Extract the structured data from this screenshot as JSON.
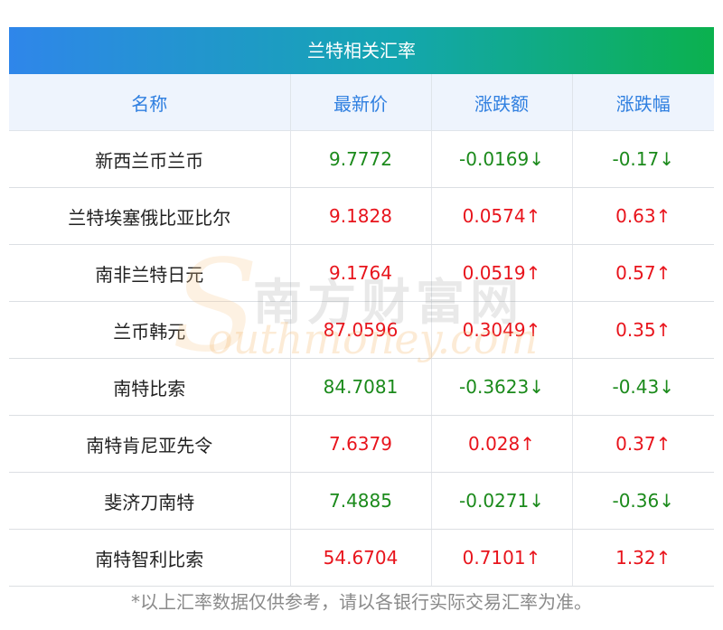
{
  "title": "兰特相关汇率",
  "headers": [
    "名称",
    "最新价",
    "涨跌额",
    "涨跌幅"
  ],
  "rows": [
    {
      "name": "新西兰币兰币",
      "price": "9.7772",
      "change": "-0.0169↓",
      "pct": "-0.17↓",
      "dir": "down"
    },
    {
      "name": "兰特埃塞俄比亚比尔",
      "price": "9.1828",
      "change": "0.0574↑",
      "pct": "0.63↑",
      "dir": "up"
    },
    {
      "name": "南非兰特日元",
      "price": "9.1764",
      "change": "0.0519↑",
      "pct": "0.57↑",
      "dir": "up"
    },
    {
      "name": "兰币韩元",
      "price": "87.0596",
      "change": "0.3049↑",
      "pct": "0.35↑",
      "dir": "up"
    },
    {
      "name": "南特比索",
      "price": "84.7081",
      "change": "-0.3623↓",
      "pct": "-0.43↓",
      "dir": "down"
    },
    {
      "name": "南特肯尼亚先令",
      "price": "7.6379",
      "change": "0.028↑",
      "pct": "0.37↑",
      "dir": "up"
    },
    {
      "name": "斐济刀南特",
      "price": "7.4885",
      "change": "-0.0271↓",
      "pct": "-0.36↓",
      "dir": "down"
    },
    {
      "name": "南特智利比索",
      "price": "54.6704",
      "change": "0.7101↑",
      "pct": "1.32↑",
      "dir": "up"
    }
  ],
  "watermark": {
    "cn": "南方财富网",
    "en": "outhmoney.com",
    "s": "S"
  },
  "footnote": "*以上汇率数据仅供参考，请以各银行实际交易汇率为准。",
  "colors": {
    "up": "#e8141c",
    "down": "#1b8a1b",
    "header_text": "#2f7fe0",
    "header_bg": "#eef4fd"
  }
}
